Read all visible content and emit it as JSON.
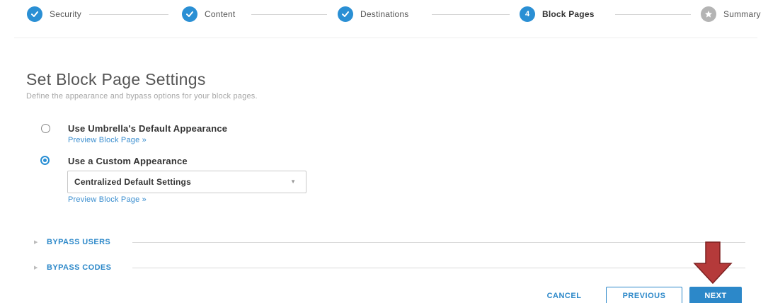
{
  "stepper": {
    "steps": [
      {
        "label": "Security",
        "state": "done",
        "icon": "check-icon"
      },
      {
        "label": "Content",
        "state": "done",
        "icon": "check-icon"
      },
      {
        "label": "Destinations",
        "state": "done",
        "icon": "check-icon"
      },
      {
        "label": "Block Pages",
        "state": "current",
        "number": "4"
      },
      {
        "label": "Summary",
        "state": "pending",
        "icon": "star-icon"
      }
    ]
  },
  "page": {
    "title": "Set Block Page Settings",
    "subtitle": "Define the appearance and bypass options for your block pages."
  },
  "appearance": {
    "options": [
      {
        "label": "Use Umbrella's Default Appearance",
        "checked": false,
        "link": "Preview Block Page »"
      },
      {
        "label": "Use a Custom Appearance",
        "checked": true,
        "link": "Preview Block Page »"
      }
    ],
    "select_value": "Centralized Default Settings"
  },
  "sections": [
    {
      "label": "BYPASS USERS",
      "expanded": false
    },
    {
      "label": "BYPASS CODES",
      "expanded": false
    }
  ],
  "buttons": {
    "cancel": "CANCEL",
    "previous": "PREVIOUS",
    "next": "NEXT"
  },
  "colors": {
    "accent": "#2c88c9",
    "step_done": "#2a8fd4",
    "step_pending": "#b4b4b4",
    "annotation_arrow": "#b53a3a"
  }
}
